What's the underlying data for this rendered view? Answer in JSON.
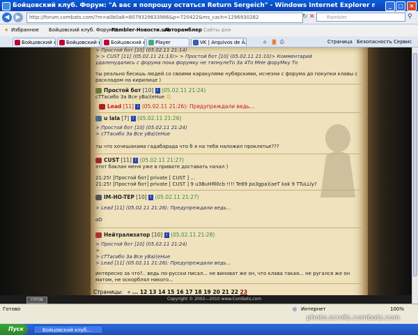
{
  "window": {
    "title": "Бойцовский клуб. Форум: \"А вас я попрошу остаться Return Sergeich\" - Windows Internet Explorer предоставлен: Rambler"
  },
  "address": {
    "url": "http://forum.combats.com/?m=a0b0a8=8079329633986&p=720422&ms_cach=1296930282",
    "search_placeholder": "Rambler"
  },
  "favorites": {
    "label": "Избранное",
    "items": [
      "Бойцовский клуб. Форум У...",
      "Rambler-Новости.url",
      "Авторамблер",
      "Сайты дня"
    ]
  },
  "tabs": [
    {
      "label": "Бойцовский клуб",
      "active": false
    },
    {
      "label": "Бойцовский клуб",
      "active": false
    },
    {
      "label": "Бойцовский к...",
      "active": true
    },
    {
      "label": "Player",
      "active": false
    },
    {
      "label": "VK | Arquivos de Â...",
      "active": false
    }
  ],
  "tools": {
    "page": "Страница",
    "safety": "Безопасность",
    "service": "Сервис"
  },
  "posts": {
    "p0": {
      "q1": "> Простой бот [10] (05.02.11 21:14)",
      "q2": "> > CUST [11] (05.02.11 21:13)> > Простой бот [10] (05.02.11 21:10)> Комментарий",
      "q3": "удаленудались с форума пока форумку не тяпнулеТо За 4То МНе форуМку То",
      "msg": "ты реально бесишь людей со своими каракулями нубярскими, исчезни с форума до покупки клавы с раскладом на кирилице )"
    },
    "p1": {
      "nick": "Простой бот",
      "level": "[10]",
      "time": "(05.02.11 21:24)",
      "msg": "сТТасибо За Все уВа)(eHue"
    },
    "p2": {
      "nick": "Lead",
      "level": "[11]",
      "time": "(05.02.11 21:26):",
      "msg": "Предупреждали ведь..."
    },
    "p3": {
      "nick": "u lala",
      "level": "[7]",
      "time": "(05.02.11 21:26)",
      "q1": "> Простой бот [10] (05.02.11 21:24)",
      "q2": "> сТТасибо За Все уВа)(eHue",
      "msg": "ты что хочешанама гадабарада что б я на тебя наложил проклятье???"
    },
    "p4": {
      "nick": "CUST",
      "level": "[11]",
      "time": "(05.02.11 21:27)",
      "msg1": "этот баклан меня уже в привате доставать начал )",
      "msg2": "21:25! [Простой бот] private [ CUST ] ...",
      "msg3": "21:25! [Простой бот] private [ CUST ] 9 u3BuHЯl0cb !!!! Te69 pa3gpa)(aeT kak 9 TTuLLly?"
    },
    "p5": {
      "nick": "IM-HO-TEP",
      "level": "[10]",
      "time": "(05.02.11 21:27)",
      "q1": "> Lead [11] (05.02.11 21:26): Предупреждали ведь...",
      "msg": "оО"
    },
    "p6": {
      "nick": "Нейтрализатор",
      "level": "[10]",
      "time": "(05.02.11 21:28)",
      "q1": "> Простой бот [10] (05.02.11 21:24)",
      "q2": ">",
      "q3": "> сТТасибо За Все уВа)(eHue",
      "q4": "> Lead [11] (05.02.11 21:26): Предупреждали ведь...",
      "msg": "интересно за что?.. ведь по-русски писал... не виноват же он, что клава такая... не ругался же он матом, не оскорблял никого..."
    }
  },
  "pagination": {
    "label": "Страницы:",
    "prev": "«",
    "pages": [
      "...",
      "12",
      "13",
      "14",
      "15",
      "16",
      "17",
      "18",
      "19",
      "20",
      "21",
      "22",
      "23"
    ],
    "current": "23"
  },
  "footer": {
    "copyright": "Copyright © 2002—2010 www.Combats.com",
    "counter": "ГОТОВ"
  },
  "status": {
    "left": "Готово",
    "zone": "Интернет",
    "zoom": "100%"
  },
  "taskbar": {
    "start": "Пуск",
    "item": "Бойцовский клуб..."
  },
  "watermark": "photo.scrolls.combats.com"
}
